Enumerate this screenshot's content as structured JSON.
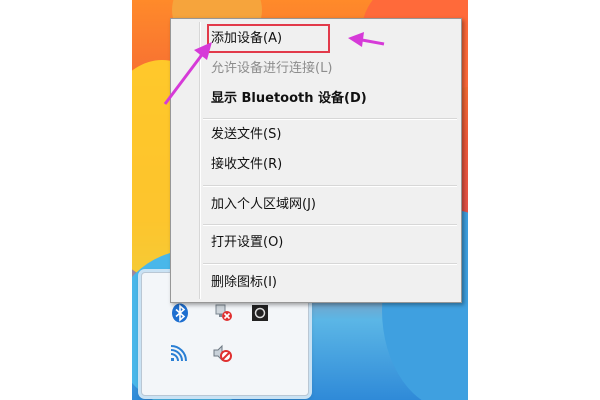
{
  "context_menu": {
    "items": [
      {
        "label": "添加设备(A)",
        "enabled": true
      },
      {
        "label": "允许设备进行连接(L)",
        "enabled": false
      },
      {
        "label": "显示 Bluetooth 设备(D)",
        "enabled": true,
        "default": true
      },
      {
        "label": "发送文件(S)",
        "enabled": true
      },
      {
        "label": "接收文件(R)",
        "enabled": true
      },
      {
        "label": "加入个人区域网(J)",
        "enabled": true
      },
      {
        "label": "打开设置(O)",
        "enabled": true
      },
      {
        "label": "删除图标(I)",
        "enabled": true
      }
    ]
  },
  "annotations": {
    "highlight_color": "#e23a4a",
    "arrow_color": "#d63ad8"
  },
  "tray_icons": [
    "bluetooth-icon",
    "network-error-icon",
    "media-icon",
    "wifi-icon",
    "volume-muted-icon"
  ]
}
